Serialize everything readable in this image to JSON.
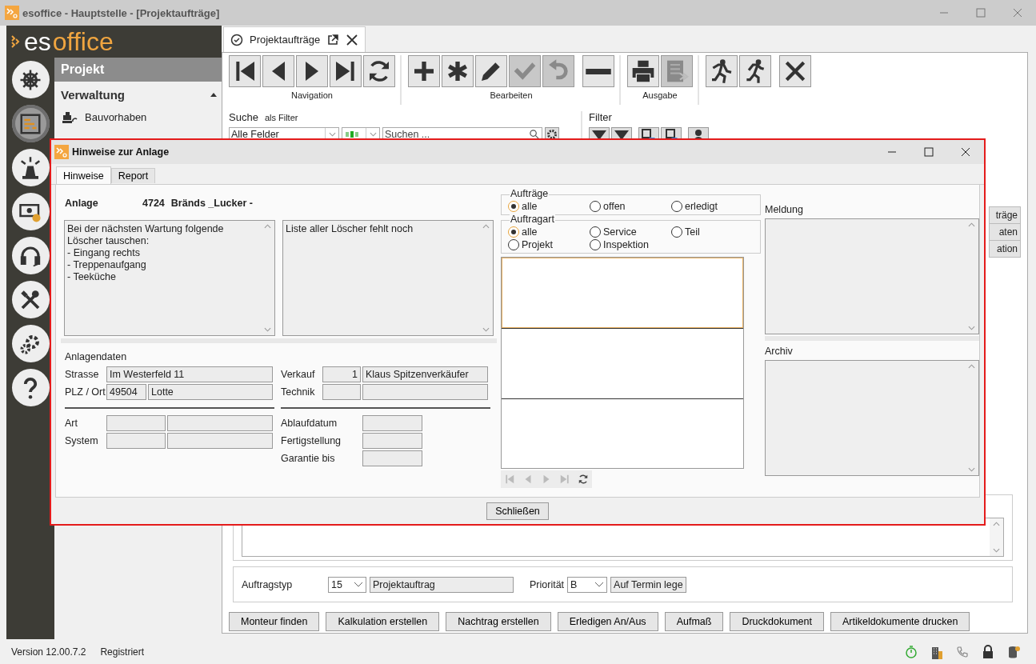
{
  "window": {
    "title": "esoffice - Hauptstelle - [Projektaufträge]"
  },
  "logo": {
    "prefix": "es",
    "suffix": "office"
  },
  "rail": [
    {
      "kind": "helm",
      "selected": false
    },
    {
      "kind": "planner",
      "selected": true
    },
    {
      "kind": "beacon",
      "selected": false
    },
    {
      "kind": "money",
      "selected": false
    },
    {
      "kind": "headset",
      "selected": false
    },
    {
      "kind": "tools",
      "selected": false
    },
    {
      "kind": "gears",
      "selected": false
    },
    {
      "kind": "help",
      "selected": false
    }
  ],
  "sidebar": {
    "header": "Projekt",
    "section": {
      "label": "Verwaltung",
      "expanded": true
    },
    "items": [
      {
        "label": "Bauvorhaben"
      }
    ]
  },
  "tab": {
    "label": "Projektaufträge"
  },
  "toolbar": {
    "groups": [
      {
        "label": "Navigation",
        "buttons": [
          {
            "kind": "first",
            "disabled": false
          },
          {
            "kind": "prev",
            "disabled": false
          },
          {
            "kind": "next",
            "disabled": false
          },
          {
            "kind": "last",
            "disabled": false
          },
          {
            "kind": "refresh",
            "disabled": false
          }
        ]
      },
      {
        "label": "Bearbeiten",
        "buttons": [
          {
            "kind": "plus",
            "disabled": false
          },
          {
            "kind": "asterisk",
            "disabled": false
          },
          {
            "kind": "pencil",
            "disabled": false
          },
          {
            "kind": "check",
            "disabled": true
          },
          {
            "kind": "undo",
            "disabled": true
          },
          {
            "kind": "minus",
            "disabled": false
          }
        ]
      },
      {
        "label": "Ausgabe",
        "buttons": [
          {
            "kind": "printer",
            "disabled": false
          },
          {
            "kind": "list",
            "disabled": true
          }
        ]
      },
      {
        "buttons": [
          {
            "kind": "run-left",
            "disabled": false
          },
          {
            "kind": "run-right",
            "disabled": false
          },
          {
            "kind": "close",
            "disabled": false
          }
        ]
      }
    ]
  },
  "search": {
    "label": "Suche",
    "mode": "als Filter",
    "field": "Alle Felder",
    "placeholder": "Suchen ..."
  },
  "filter": {
    "label": "Filter"
  },
  "side_tabs": [
    "träge",
    "aten",
    "ation"
  ],
  "order": {
    "type_label": "Auftragstyp",
    "type_code": "15",
    "type_name": "Projektauftrag",
    "priority_label": "Priorität",
    "priority": "B",
    "priority_name": "Auf Termin lege"
  },
  "actions": [
    "Monteur finden",
    "Kalkulation erstellen",
    "Nachtrag erstellen",
    "Erledigen An/Aus",
    "Aufmaß",
    "Druckdokument",
    "Artikeldokumente drucken"
  ],
  "status_bar": {
    "version": "Version 12.00.7.2",
    "registration": "Registriert"
  },
  "dialog": {
    "title": "Hinweise zur Anlage",
    "tabs": [
      {
        "label": "Hinweise",
        "selected": true
      },
      {
        "label": "Report",
        "selected": false
      }
    ],
    "plant": {
      "label": "Anlage",
      "number": "4724",
      "name": "Bränds _Lucker -"
    },
    "notes": [
      "Bei der nächsten Wartung folgende\nLöscher tauschen:\n- Eingang rechts\n- Treppenaufgang\n- Teeküche",
      "Liste aller Löscher fehlt noch"
    ],
    "plant_data": {
      "title": "Anlagendaten",
      "street_label": "Strasse",
      "street": "Im Westerfeld 11",
      "city_label": "PLZ / Ort",
      "zip": "49504",
      "city": "Lotte",
      "sales_label": "Verkauf",
      "sales_no": "1",
      "sales_name": "Klaus Spitzenverkäufer",
      "tech_label": "Technik",
      "kind_label": "Art",
      "system_label": "System",
      "expiry_label": "Ablaufdatum",
      "completion_label": "Fertigstellung",
      "warranty_label": "Garantie bis"
    },
    "orders_filter": {
      "title": "Aufträge",
      "options": [
        {
          "label": "alle",
          "selected": true
        },
        {
          "label": "offen",
          "selected": false
        },
        {
          "label": "erledigt",
          "selected": false
        }
      ]
    },
    "order_type_filter": {
      "title": "Auftragart",
      "options": [
        {
          "label": "alle",
          "selected": true
        },
        {
          "label": "Service",
          "selected": false
        },
        {
          "label": "Teil",
          "selected": false
        },
        {
          "label": "Projekt",
          "selected": false
        },
        {
          "label": "Inspektion",
          "selected": false
        }
      ]
    },
    "message": {
      "label": "Meldung"
    },
    "archive": {
      "label": "Archiv"
    },
    "close_button": "Schließen"
  }
}
